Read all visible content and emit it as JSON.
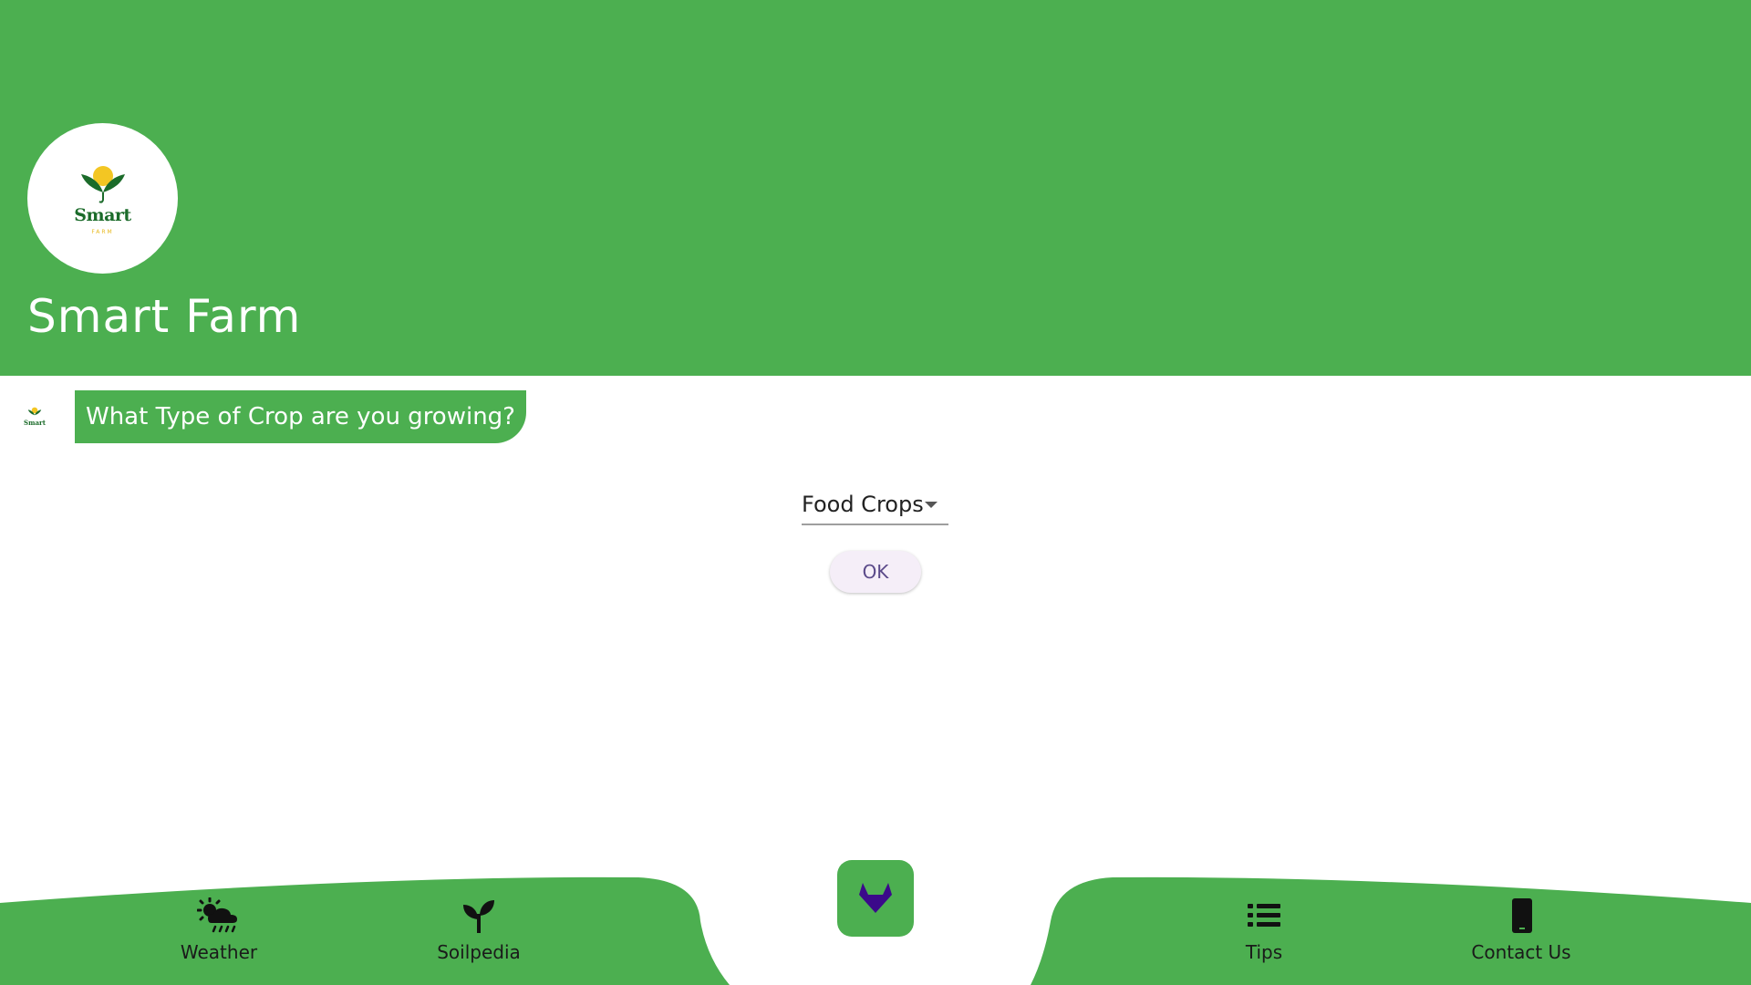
{
  "app": {
    "title": "Smart Farm",
    "logo_word": "Smart",
    "logo_sub": "FARM"
  },
  "chat": {
    "question": "What Type of Crop are you growing?"
  },
  "crop_select": {
    "value": "Food Crops"
  },
  "actions": {
    "ok_label": "OK"
  },
  "bottom_nav": {
    "weather": {
      "label": "Weather",
      "icon": "weather-icon"
    },
    "soilpedia": {
      "label": "Soilpedia",
      "icon": "sprout-icon"
    },
    "center": {
      "icon": "gitlab-icon"
    },
    "tips": {
      "label": "Tips",
      "icon": "list-icon"
    },
    "contact": {
      "label": "Contact Us",
      "icon": "phone-icon"
    }
  },
  "colors": {
    "primary": "#4caf50",
    "fab_icon": "#3b0a8a"
  }
}
